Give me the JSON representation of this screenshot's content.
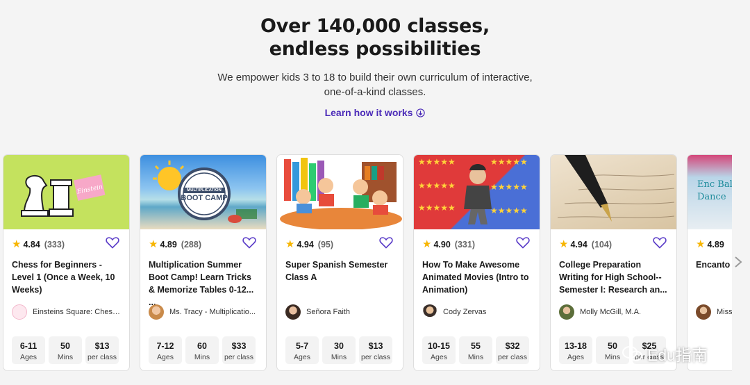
{
  "hero": {
    "headline_line1": "Over 140,000 classes,",
    "headline_line2": "endless possibilities",
    "subtitle": "We empower kids 3 to 18 to build their own curriculum of interactive, one-of-a-kind classes.",
    "learn_link": "Learn how it works"
  },
  "stat_labels": {
    "ages": "Ages",
    "mins": "Mins",
    "price": "per class"
  },
  "cards": [
    {
      "rating": "4.84",
      "count": "(333)",
      "title": "Chess for Beginners - Level 1 (Once a Week, 10 Weeks)",
      "teacher": "Einsteins Square: Chess,...",
      "ages": "6-11",
      "mins": "50",
      "price": "$13"
    },
    {
      "rating": "4.89",
      "count": "(288)",
      "title": "Multiplication Summer Boot Camp! Learn Tricks & Memorize Tables 0-12... ...",
      "teacher": "Ms. Tracy - Multiplicatio...",
      "ages": "7-12",
      "mins": "60",
      "price": "$33",
      "thumb_badge": "MULTIPLICATION",
      "thumb_text": "BOOT CAMP"
    },
    {
      "rating": "4.94",
      "count": "(95)",
      "title": "Super Spanish Semester Class A",
      "teacher": "Señora Faith",
      "ages": "5-7",
      "mins": "30",
      "price": "$13"
    },
    {
      "rating": "4.90",
      "count": "(331)",
      "title": "How To Make Awesome Animated Movies (Intro to Animation)",
      "teacher": "Cody Zervas",
      "ages": "10-15",
      "mins": "55",
      "price": "$32"
    },
    {
      "rating": "4.94",
      "count": "(104)",
      "title": "College Preparation Writing for High School-- Semester I: Research an...",
      "teacher": "Molly McGill, M.A.",
      "ages": "13-18",
      "mins": "50",
      "price": "$25"
    },
    {
      "rating": "4.89",
      "count": "",
      "title": "Encanto Class!",
      "teacher": "Miss",
      "ages": "",
      "mins": "",
      "price": "",
      "thumb_text": "Enc Bal Dance"
    }
  ],
  "watermark": "Edu指南",
  "colors": {
    "accent": "#4b2bb8",
    "star": "#f7b500",
    "card_bg": "#ffffff",
    "page_bg": "#f4f4f4"
  }
}
